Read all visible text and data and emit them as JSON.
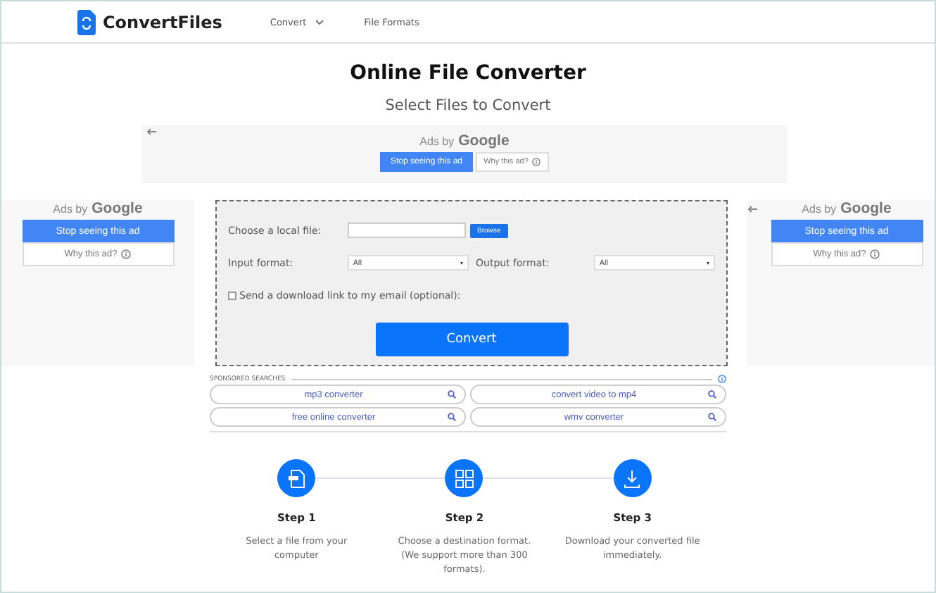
{
  "header": {
    "brand": "ConvertFiles",
    "nav": [
      {
        "label": "Convert",
        "dropdown": true
      },
      {
        "label": "File Formats",
        "dropdown": false
      }
    ]
  },
  "title": "Online File Converter",
  "subtitle": "Select Files to Convert",
  "ads": [
    {
      "kind": "banner",
      "ads_by": "Ads by",
      "google": "Google",
      "stop": "Stop seeing this ad",
      "why": "Why this ad?"
    },
    {
      "kind": "panel",
      "ads_by": "Ads by",
      "google": "Google",
      "stop": "Stop seeing this ad",
      "why": "Why this ad?"
    },
    {
      "kind": "panel",
      "ads_by": "Ads by",
      "google": "Google",
      "stop": "Stop seeing this ad",
      "why": "Why this ad?"
    }
  ],
  "form": {
    "file_label": "Choose a local file:",
    "browse": "Browse",
    "input_label": "Input format:",
    "input_value": "All",
    "output_label": "Output format:",
    "output_value": "All",
    "email_label": "Send a download link to my email (optional):",
    "email_checked": false,
    "convert": "Convert"
  },
  "sponsored": {
    "heading": "SPONSORED SEARCHES",
    "links": [
      "mp3 converter",
      "convert video to mp4",
      "free online converter",
      "wmv converter"
    ]
  },
  "steps": [
    {
      "title": "Step 1",
      "text": "Select a file from your computer",
      "kind": "file"
    },
    {
      "title": "Step 2",
      "text": "Choose a destination format. (We support more than 300 formats).",
      "kind": "grid"
    },
    {
      "title": "Step 3",
      "text": "Download your converted file immediately.",
      "kind": "download"
    }
  ]
}
